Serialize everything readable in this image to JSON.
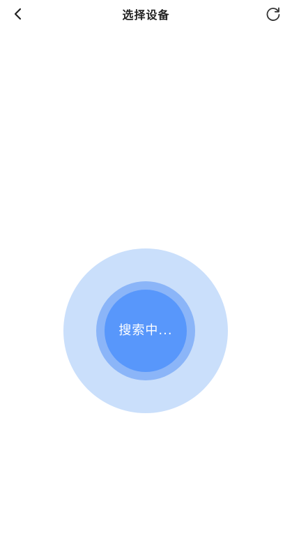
{
  "header": {
    "title": "选择设备",
    "back_icon": "chevron-left-icon",
    "refresh_icon": "refresh-icon"
  },
  "scanner": {
    "status_text": "搜索中...",
    "colors": {
      "outer": "#cadffb",
      "middle": "#8bb5f8",
      "inner": "#5897fb"
    }
  }
}
